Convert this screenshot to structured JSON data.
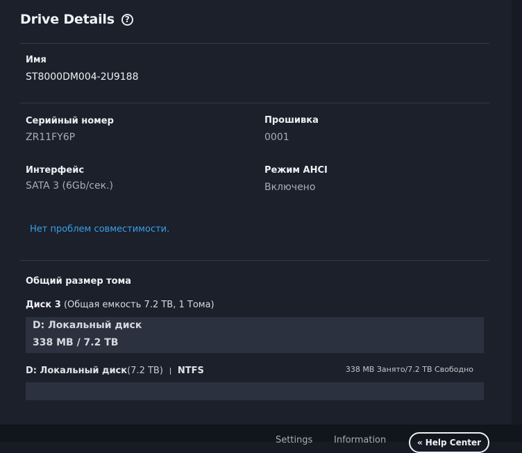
{
  "header": {
    "title": "Drive Details",
    "help_glyph": "?"
  },
  "name": {
    "label": "Имя",
    "value": "ST8000DM004-2U9188"
  },
  "serial": {
    "label": "Серийный номер",
    "value": "ZR11FY6P"
  },
  "firmware": {
    "label": "Прошивка",
    "value": "0001"
  },
  "interface": {
    "label": "Интерфейс",
    "value": "SATA 3 (6Gb/сек.)"
  },
  "ahci": {
    "label": "Режим AHCI",
    "value": "Включено"
  },
  "compatibility": {
    "text": "Нет проблем совместимости."
  },
  "volume_total": {
    "label": "Общий размер тома"
  },
  "disk": {
    "name": "Диск 3",
    "info": "(Общая емкость 7.2 TB, 1 Тома)"
  },
  "volume": {
    "name": "D: Локальный диск",
    "size": "338 MB / 7.2 TB"
  },
  "partition": {
    "name": "D: Локальный диск",
    "size": "(7.2 TB)",
    "fs": "NTFS",
    "usage": "338 MB Занято/7.2 TB Свободно",
    "used_fraction": 5e-05
  },
  "footer": {
    "settings": "Settings",
    "information": "Information",
    "help_center": "Help Center",
    "help_center_glyph": "«"
  },
  "colors": {
    "background": "#1b202b",
    "accent_link": "#3aa0e8",
    "bar": "#2b313e"
  }
}
